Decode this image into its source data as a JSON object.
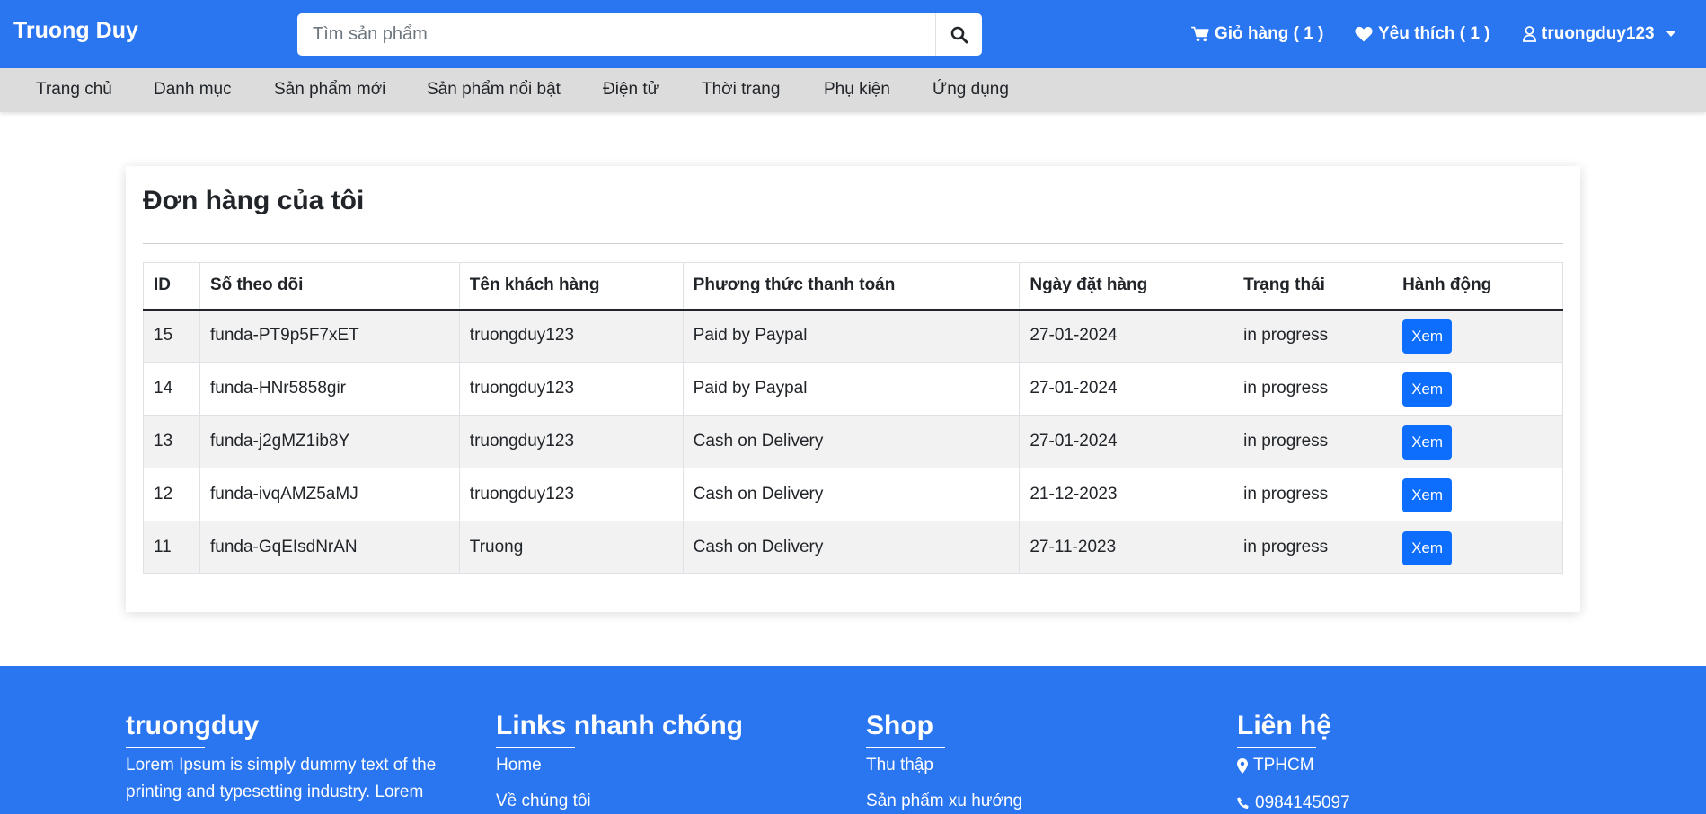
{
  "brand": "Truong Duy",
  "search": {
    "placeholder": "Tìm sản phẩm"
  },
  "top_links": {
    "cart": "Giỏ hàng ( 1 )",
    "wishlist": "Yêu thích ( 1 )",
    "user": "truongduy123"
  },
  "nav": [
    "Trang chủ",
    "Danh mục",
    "Sản phẩm mới",
    "Sản phẩm nổi bật",
    "Điện tử",
    "Thời trang",
    "Phụ kiện",
    "Ứng dụng"
  ],
  "orders": {
    "title": "Đơn hàng của tôi",
    "headers": [
      "ID",
      "Số theo dõi",
      "Tên khách hàng",
      "Phương thức thanh toán",
      "Ngày đặt hàng",
      "Trạng thái",
      "Hành động"
    ],
    "rows": [
      [
        "15",
        "funda-PT9p5F7xET",
        "truongduy123",
        "Paid by Paypal",
        "27-01-2024",
        "in progress",
        "Xem"
      ],
      [
        "14",
        "funda-HNr5858gir",
        "truongduy123",
        "Paid by Paypal",
        "27-01-2024",
        "in progress",
        "Xem"
      ],
      [
        "13",
        "funda-j2gMZ1ib8Y",
        "truongduy123",
        "Cash on Delivery",
        "27-01-2024",
        "in progress",
        "Xem"
      ],
      [
        "12",
        "funda-ivqAMZ5aMJ",
        "truongduy123",
        "Cash on Delivery",
        "21-12-2023",
        "in progress",
        "Xem"
      ],
      [
        "11",
        "funda-GqEIsdNrAN",
        "Truong",
        "Cash on Delivery",
        "27-11-2023",
        "in progress",
        "Xem"
      ]
    ]
  },
  "footer": {
    "about": {
      "heading": "truongduy",
      "text": "Lorem Ipsum is simply dummy text of the printing and typesetting industry. Lorem"
    },
    "links": {
      "heading": "Links nhanh chóng",
      "items": [
        "Home",
        "Về chúng tôi"
      ]
    },
    "shop": {
      "heading": "Shop",
      "items": [
        "Thu thập",
        "Sản phẩm xu hướng"
      ]
    },
    "contact": {
      "heading": "Liên hệ",
      "address": "TPHCM",
      "phone": "0984145097"
    }
  },
  "colors": {
    "primary": "#2a75f0",
    "nav_bg": "#dcdcdc",
    "button": "#0d6efd",
    "stripe": "#f2f2f2"
  },
  "icons": {
    "search": "search-icon",
    "cart": "cart-icon",
    "wishlist": "heart-icon",
    "user": "user-icon",
    "dropdown": "caret-down-icon",
    "address": "map-marker-icon",
    "phone": "phone-icon"
  }
}
